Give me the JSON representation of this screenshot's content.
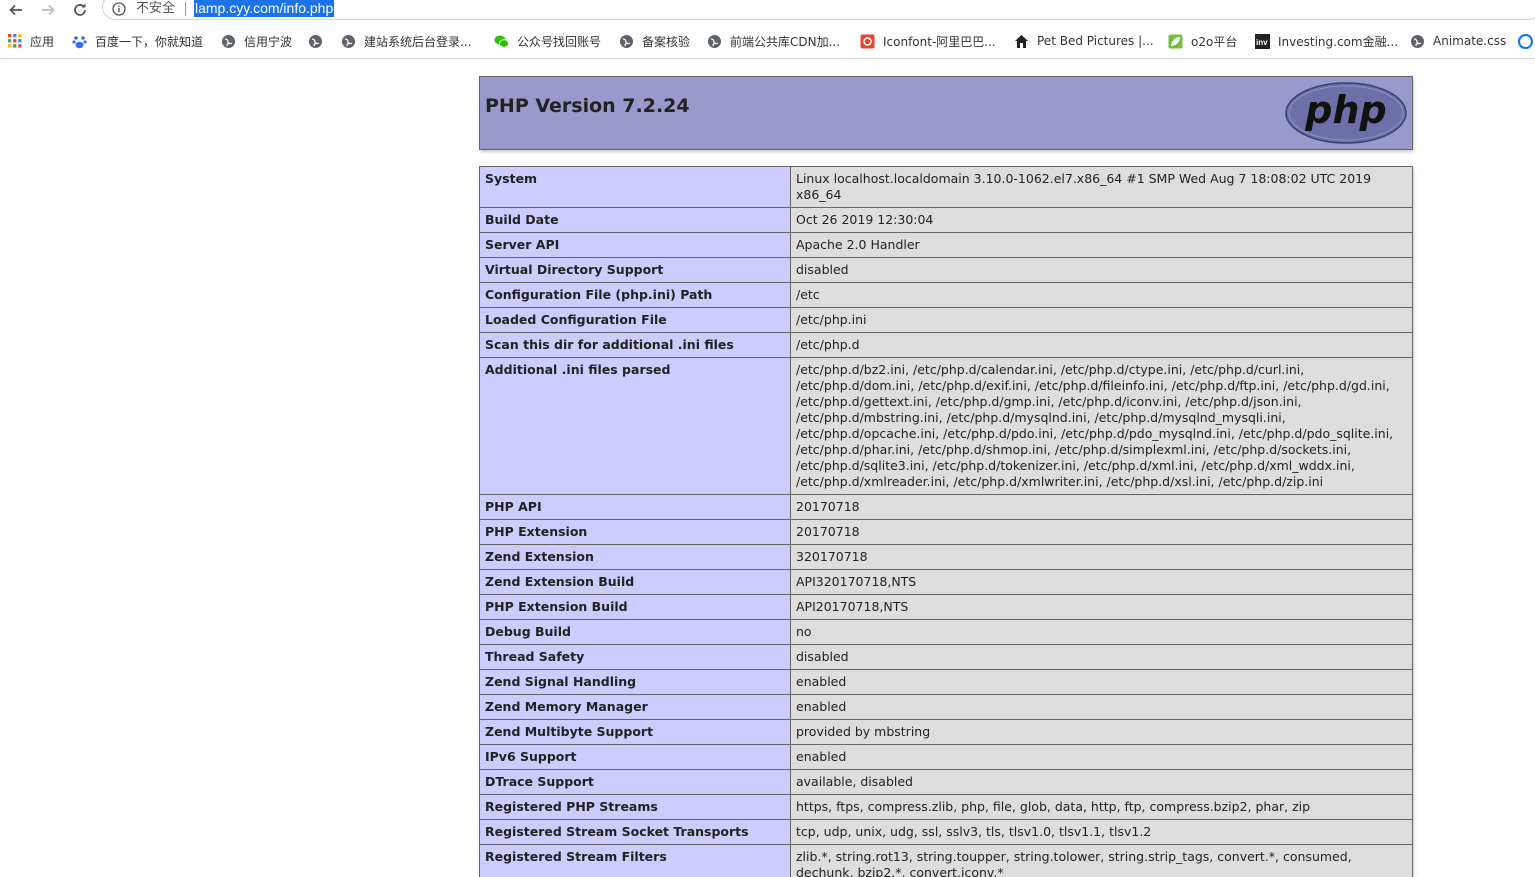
{
  "browser": {
    "security_label": "不安全",
    "url": "lamp.cyy.com/info.php"
  },
  "bookmarks": [
    {
      "label": "应用",
      "icon": "apps-grid-icon"
    },
    {
      "label": "百度一下，你就知道",
      "icon": "baidu-paw-icon"
    },
    {
      "label": "信用宁波",
      "icon": "globe-icon"
    },
    {
      "label": "",
      "icon": "globe-icon"
    },
    {
      "label": "建站系统后台登录...",
      "icon": "globe-icon"
    },
    {
      "label": "公众号找回账号",
      "icon": "wechat-icon"
    },
    {
      "label": "备案核验",
      "icon": "globe-icon"
    },
    {
      "label": "前端公共库CDN加...",
      "icon": "globe-icon"
    },
    {
      "label": "Iconfont-阿里巴巴...",
      "icon": "iconfont-icon"
    },
    {
      "label": "Pet Bed Pictures |...",
      "icon": "house-icon"
    },
    {
      "label": "o2o平台",
      "icon": "leaf-icon"
    },
    {
      "label": "Investing.com金融...",
      "icon": "investing-icon"
    },
    {
      "label": "Animate.css",
      "icon": "globe-icon"
    },
    {
      "label": "",
      "icon": "edge-icon"
    }
  ],
  "header": {
    "version_text": "PHP Version 7.2.24",
    "logo_text": "php"
  },
  "rows": [
    {
      "key": "System",
      "value": "Linux localhost.localdomain 3.10.0-1062.el7.x86_64 #1 SMP Wed Aug 7 18:08:02 UTC 2019 x86_64"
    },
    {
      "key": "Build Date",
      "value": "Oct 26 2019 12:30:04"
    },
    {
      "key": "Server API",
      "value": "Apache 2.0 Handler"
    },
    {
      "key": "Virtual Directory Support",
      "value": "disabled"
    },
    {
      "key": "Configuration File (php.ini) Path",
      "value": "/etc"
    },
    {
      "key": "Loaded Configuration File",
      "value": "/etc/php.ini"
    },
    {
      "key": "Scan this dir for additional .ini files",
      "value": "/etc/php.d"
    },
    {
      "key": "Additional .ini files parsed",
      "value": "/etc/php.d/bz2.ini, /etc/php.d/calendar.ini, /etc/php.d/ctype.ini, /etc/php.d/curl.ini, /etc/php.d/dom.ini, /etc/php.d/exif.ini, /etc/php.d/fileinfo.ini, /etc/php.d/ftp.ini, /etc/php.d/gd.ini, /etc/php.d/gettext.ini, /etc/php.d/gmp.ini, /etc/php.d/iconv.ini, /etc/php.d/json.ini, /etc/php.d/mbstring.ini, /etc/php.d/mysqlnd.ini, /etc/php.d/mysqlnd_mysqli.ini, /etc/php.d/opcache.ini, /etc/php.d/pdo.ini, /etc/php.d/pdo_mysqlnd.ini, /etc/php.d/pdo_sqlite.ini, /etc/php.d/phar.ini, /etc/php.d/shmop.ini, /etc/php.d/simplexml.ini, /etc/php.d/sockets.ini, /etc/php.d/sqlite3.ini, /etc/php.d/tokenizer.ini, /etc/php.d/xml.ini, /etc/php.d/xml_wddx.ini, /etc/php.d/xmlreader.ini, /etc/php.d/xmlwriter.ini, /etc/php.d/xsl.ini, /etc/php.d/zip.ini"
    },
    {
      "key": "PHP API",
      "value": "20170718"
    },
    {
      "key": "PHP Extension",
      "value": "20170718"
    },
    {
      "key": "Zend Extension",
      "value": "320170718"
    },
    {
      "key": "Zend Extension Build",
      "value": "API320170718,NTS"
    },
    {
      "key": "PHP Extension Build",
      "value": "API20170718,NTS"
    },
    {
      "key": "Debug Build",
      "value": "no"
    },
    {
      "key": "Thread Safety",
      "value": "disabled"
    },
    {
      "key": "Zend Signal Handling",
      "value": "enabled"
    },
    {
      "key": "Zend Memory Manager",
      "value": "enabled"
    },
    {
      "key": "Zend Multibyte Support",
      "value": "provided by mbstring"
    },
    {
      "key": "IPv6 Support",
      "value": "enabled"
    },
    {
      "key": "DTrace Support",
      "value": "available, disabled"
    },
    {
      "key": "Registered PHP Streams",
      "value": "https, ftps, compress.zlib, php, file, glob, data, http, ftp, compress.bzip2, phar, zip"
    },
    {
      "key": "Registered Stream Socket Transports",
      "value": "tcp, udp, unix, udg, ssl, sslv3, tls, tlsv1.0, tlsv1.1, tlsv1.2"
    },
    {
      "key": "Registered Stream Filters",
      "value": "zlib.*, string.rot13, string.toupper, string.tolower, string.strip_tags, convert.*, consumed, dechunk, bzip2.*, convert.iconv.*"
    }
  ],
  "colors": {
    "header_bg": "#9999cc",
    "key_bg": "#ccccff",
    "value_bg": "#dddddd",
    "url_highlight": "#1a73e8"
  }
}
